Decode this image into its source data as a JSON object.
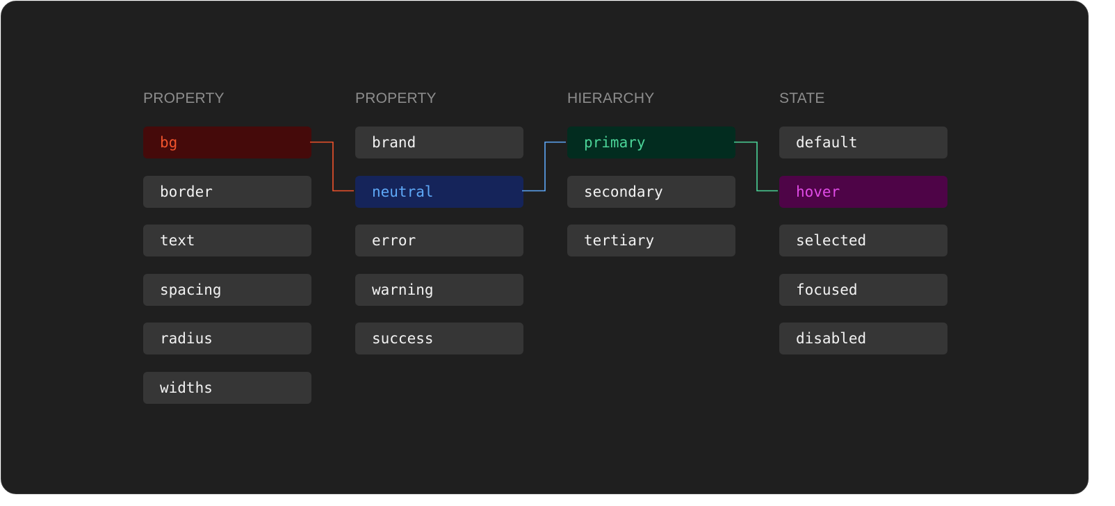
{
  "columns": [
    {
      "header": "PROPERTY",
      "items": [
        "bg",
        "border",
        "text",
        "spacing",
        "radius",
        "widths"
      ],
      "selected_index": 0
    },
    {
      "header": "PROPERTY",
      "items": [
        "brand",
        "neutral",
        "error",
        "warning",
        "success"
      ],
      "selected_index": 1
    },
    {
      "header": "HIERARCHY",
      "items": [
        "primary",
        "secondary",
        "tertiary"
      ],
      "selected_index": 0
    },
    {
      "header": "STATE",
      "items": [
        "default",
        "hover",
        "selected",
        "focused",
        "disabled"
      ],
      "selected_index": 1
    }
  ],
  "highlight_colors": [
    {
      "bg": "#450a0a",
      "text": "#f0532c",
      "line": "#f0532c"
    },
    {
      "bg": "#15245a",
      "text": "#5ea8f7",
      "line": "#5ea8f7"
    },
    {
      "bg": "#022c1f",
      "text": "#4bd498",
      "line": "#4bd498"
    },
    {
      "bg": "#4e0447",
      "text": "#e04be6",
      "line": null
    }
  ],
  "colors": {
    "background": "#1f1f1f",
    "chip": "#363636",
    "chip_text": "#f2f2f2",
    "header_text": "#8d8d8d"
  }
}
